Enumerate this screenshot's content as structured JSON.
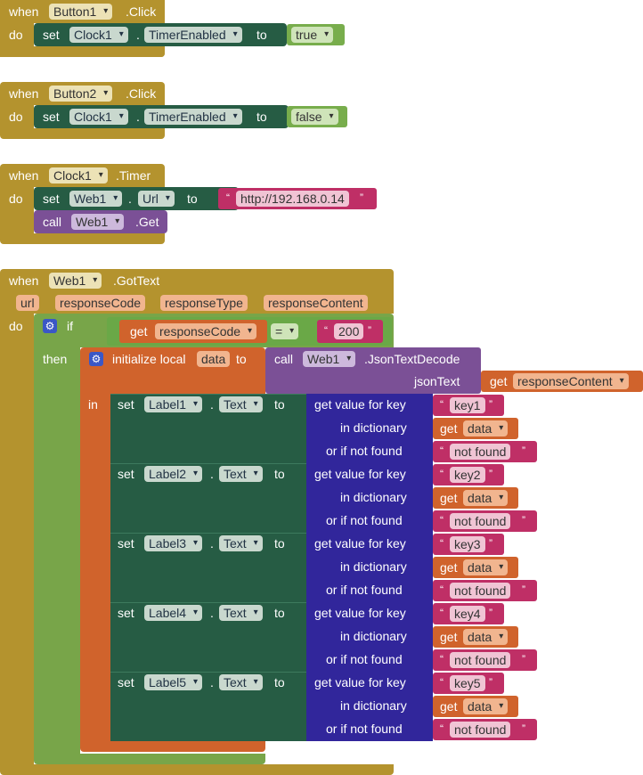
{
  "kw": {
    "when": "when",
    "do": "do",
    "set": "set",
    "to": "to",
    "call": "call",
    "if": "if",
    "then": "then",
    "in": "in",
    "get": "get",
    "dot": ".",
    "init_local": "initialize local",
    "get_value_for_key": "get value for key",
    "in_dictionary": "in dictionary",
    "or_if_not_found": "or if not found",
    "json_text": "jsonText"
  },
  "block1": {
    "component": "Button1",
    "event": ".Click",
    "target": "Clock1",
    "property": "TimerEnabled",
    "value": "true"
  },
  "block2": {
    "component": "Button2",
    "event": ".Click",
    "target": "Clock1",
    "property": "TimerEnabled",
    "value": "false"
  },
  "block3": {
    "component": "Clock1",
    "event": ".Timer",
    "target": "Web1",
    "property": "Url",
    "url": "http://192.168.0.14",
    "call_target": "Web1",
    "method": ".Get"
  },
  "block4": {
    "component": "Web1",
    "event": ".GotText",
    "params": [
      "url",
      "responseCode",
      "responseType",
      "responseContent"
    ],
    "if_var": "responseCode",
    "op": "=",
    "compare": "200",
    "local_name": "data",
    "decode_target": "Web1",
    "decode_method": ".JsonTextDecode",
    "json_var": "responseContent",
    "rows": [
      {
        "label": "Label1",
        "prop": "Text",
        "key": "key1",
        "dict": "data",
        "notfound": "not found"
      },
      {
        "label": "Label2",
        "prop": "Text",
        "key": "key2",
        "dict": "data",
        "notfound": "not found"
      },
      {
        "label": "Label3",
        "prop": "Text",
        "key": "key3",
        "dict": "data",
        "notfound": "not found"
      },
      {
        "label": "Label4",
        "prop": "Text",
        "key": "key4",
        "dict": "data",
        "notfound": "not found"
      },
      {
        "label": "Label5",
        "prop": "Text",
        "key": "key5",
        "dict": "data",
        "notfound": "not found"
      }
    ]
  },
  "icons": {
    "mutator": "gear-icon",
    "dropdown": "chevron-down-icon",
    "quote": "quote-icon"
  },
  "colors": {
    "event": "#b4932e",
    "setter": "#265c44",
    "method": "#7b5096",
    "control": "#78a549",
    "variable": "#d0632c",
    "dictionary": "#31269b",
    "text": "#bf2f66",
    "logic": "#78ad4c"
  }
}
